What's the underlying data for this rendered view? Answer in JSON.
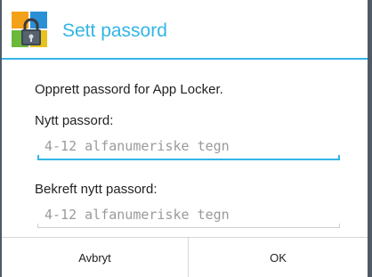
{
  "dialog": {
    "title": "Sett passord",
    "prompt": "Opprett passord for App Locker.",
    "new_password": {
      "label": "Nytt passord:",
      "placeholder": "4-12 alfanumeriske tegn",
      "value": ""
    },
    "confirm_password": {
      "label": "Bekreft nytt passord:",
      "placeholder": "4-12 alfanumeriske tegn",
      "value": ""
    },
    "buttons": {
      "cancel": "Avbryt",
      "ok": "OK"
    }
  },
  "icons": {
    "app_icon": "app-locker-padlock-icon"
  },
  "colors": {
    "accent": "#33b5e5",
    "frame": "#4f5a66",
    "text": "#222222",
    "hint": "#9a9a9a"
  }
}
